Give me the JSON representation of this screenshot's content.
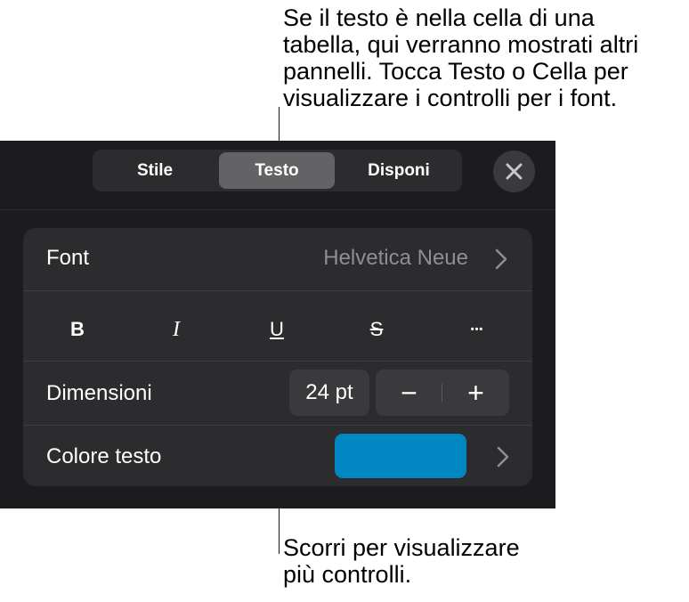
{
  "callouts": {
    "top": "Se il testo è nella cella di una\ntabella, qui verranno mostrati altri\npannelli. Tocca Testo o Cella per\nvisualizzare i controlli per i font.",
    "bottom": "Scorri per visualizzare\npiù controlli."
  },
  "tabs": [
    {
      "label": "Stile",
      "selected": false
    },
    {
      "label": "Testo",
      "selected": true
    },
    {
      "label": "Disponi",
      "selected": false
    }
  ],
  "close_icon": "close-icon",
  "font_row": {
    "label": "Font",
    "value": "Helvetica Neue"
  },
  "style_buttons": [
    {
      "name": "bold",
      "glyph": "B"
    },
    {
      "name": "italic",
      "glyph": "I"
    },
    {
      "name": "underline",
      "glyph": "U"
    },
    {
      "name": "strikethrough",
      "glyph": "S"
    },
    {
      "name": "more",
      "glyph": "•••"
    }
  ],
  "size_row": {
    "label": "Dimensioni",
    "value": "24 pt",
    "decrement": "−",
    "increment": "+"
  },
  "color_row": {
    "label": "Colore testo",
    "color": "#0086c0"
  },
  "colors": {
    "panel": "#1c1c1e",
    "card": "#2c2c2e",
    "selected_tab": "#636366",
    "secondary_text": "#8e8e93"
  }
}
